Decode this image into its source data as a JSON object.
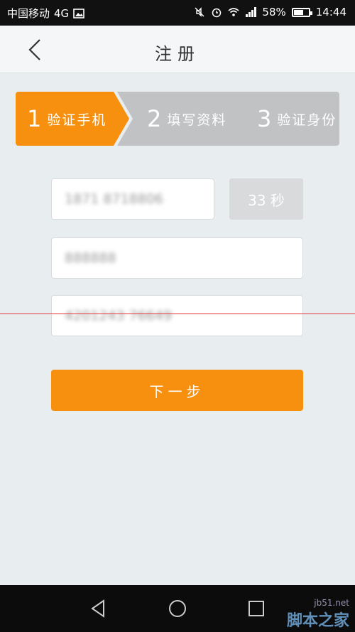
{
  "status_bar": {
    "carrier": "中国移动",
    "network": "4G",
    "battery": "58%",
    "time": "14:44"
  },
  "nav": {
    "title": "注册"
  },
  "steps": [
    {
      "num": "1",
      "label": "验证手机"
    },
    {
      "num": "2",
      "label": "填写资料"
    },
    {
      "num": "3",
      "label": "验证身份"
    }
  ],
  "form": {
    "phone_value": "1871 8718806",
    "countdown": "33 秒",
    "code_value": "888888",
    "id_value": "4201243 76649"
  },
  "next_button": "下一步",
  "watermark": {
    "text": "脚本之家",
    "site": "jb51.net"
  },
  "colors": {
    "accent": "#f7900f",
    "inactive_step": "#c1c2c4",
    "background": "#e8eef0"
  }
}
